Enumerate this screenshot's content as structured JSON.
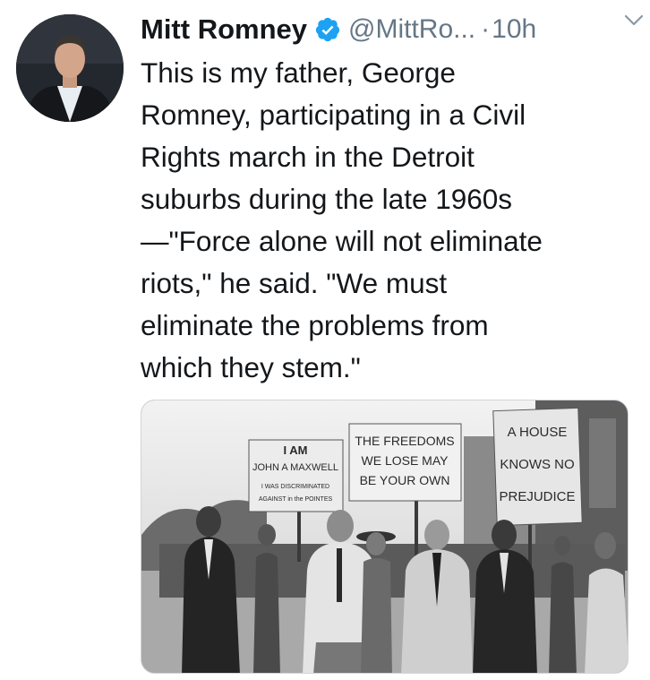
{
  "tweet": {
    "author_name": "Mitt Romney",
    "handle": "@MittRo...",
    "separator": "·",
    "time": "10h",
    "verified": true,
    "text_lines": [
      "This is my father, George",
      "Romney, participating in a Civil",
      "Rights march in the Detroit",
      "suburbs during the late 1960s",
      "—\"Force alone will not eliminate",
      "riots,\" he said. \"We must",
      "eliminate the problems from",
      "which they stem.\""
    ]
  },
  "photo": {
    "signs": {
      "sign1_line1": "I AM",
      "sign1_line2": "JOHN A MAXWELL",
      "sign1_line3": "I WAS DISCRIMINATED",
      "sign1_line4": "AGAINST in the POINTES",
      "sign2_line1": "THE FREEDOMS",
      "sign2_line2": "WE LOSE MAY",
      "sign2_line3": "BE YOUR OWN",
      "sign3_line1": "A HOUSE",
      "sign3_line2": "KNOWS NO",
      "sign3_line3": "PREJUDICE"
    }
  },
  "colors": {
    "verified_blue": "#1da1f2",
    "secondary_text": "#657786",
    "primary_text": "#14171a"
  },
  "icons": {
    "verified": "verified-badge-icon",
    "caret": "chevron-down-icon"
  }
}
